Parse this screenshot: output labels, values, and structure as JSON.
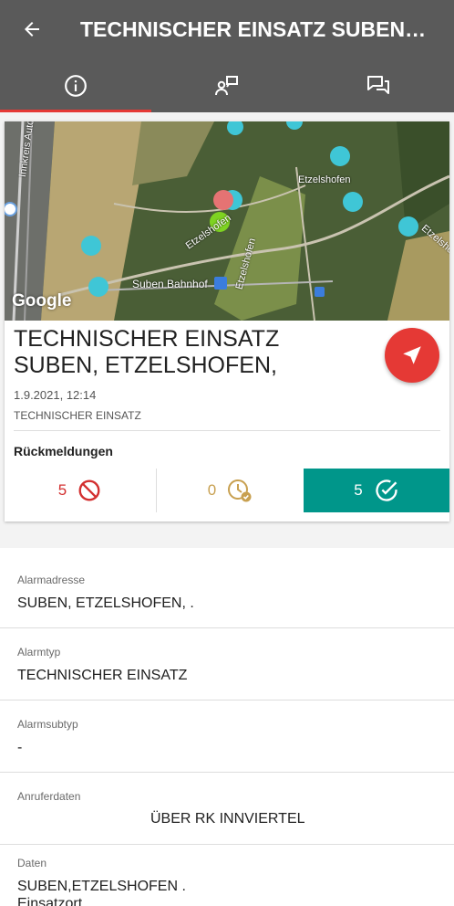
{
  "appbar": {
    "title": "TECHNISCHER EINSATZ SUBEN, E..."
  },
  "tabs": [
    {
      "name": "info",
      "icon": "info-icon",
      "active": true
    },
    {
      "name": "members",
      "icon": "person-status-icon",
      "active": false
    },
    {
      "name": "chat",
      "icon": "chat-icon",
      "active": false
    }
  ],
  "map": {
    "brand": "Google",
    "labels": {
      "highway": "Innkreis Autob",
      "village1": "Etzelshofen",
      "village2": "Etzelshofen",
      "village3": "Etzelshofen",
      "village4": "Etzelshofen",
      "station": "Suben Bahnhof"
    }
  },
  "incident": {
    "title": "TECHNISCHER EINSATZ SUBEN, ETZELSHOFEN,",
    "datetime": "1.9.2021, 12:14",
    "category": "TECHNISCHER EINSATZ"
  },
  "responses": {
    "heading": "Rückmeldungen",
    "declined": "5",
    "pending": "0",
    "accepted": "5",
    "colors": {
      "declined": "#d32f2f",
      "pending": "#c8a050",
      "accepted": "#00968a"
    }
  },
  "details": [
    {
      "label": "Alarmadresse",
      "value": "SUBEN, ETZELSHOFEN, ."
    },
    {
      "label": "Alarmtyp",
      "value": "TECHNISCHER EINSATZ"
    },
    {
      "label": "Alarmsubtyp",
      "value": "-"
    },
    {
      "label": "Anruferdaten",
      "value": "ÜBER RK INNVIERTEL"
    },
    {
      "label": "Daten",
      "value": "SUBEN,ETZELSHOFEN .",
      "value2": "Einsatzort"
    }
  ]
}
